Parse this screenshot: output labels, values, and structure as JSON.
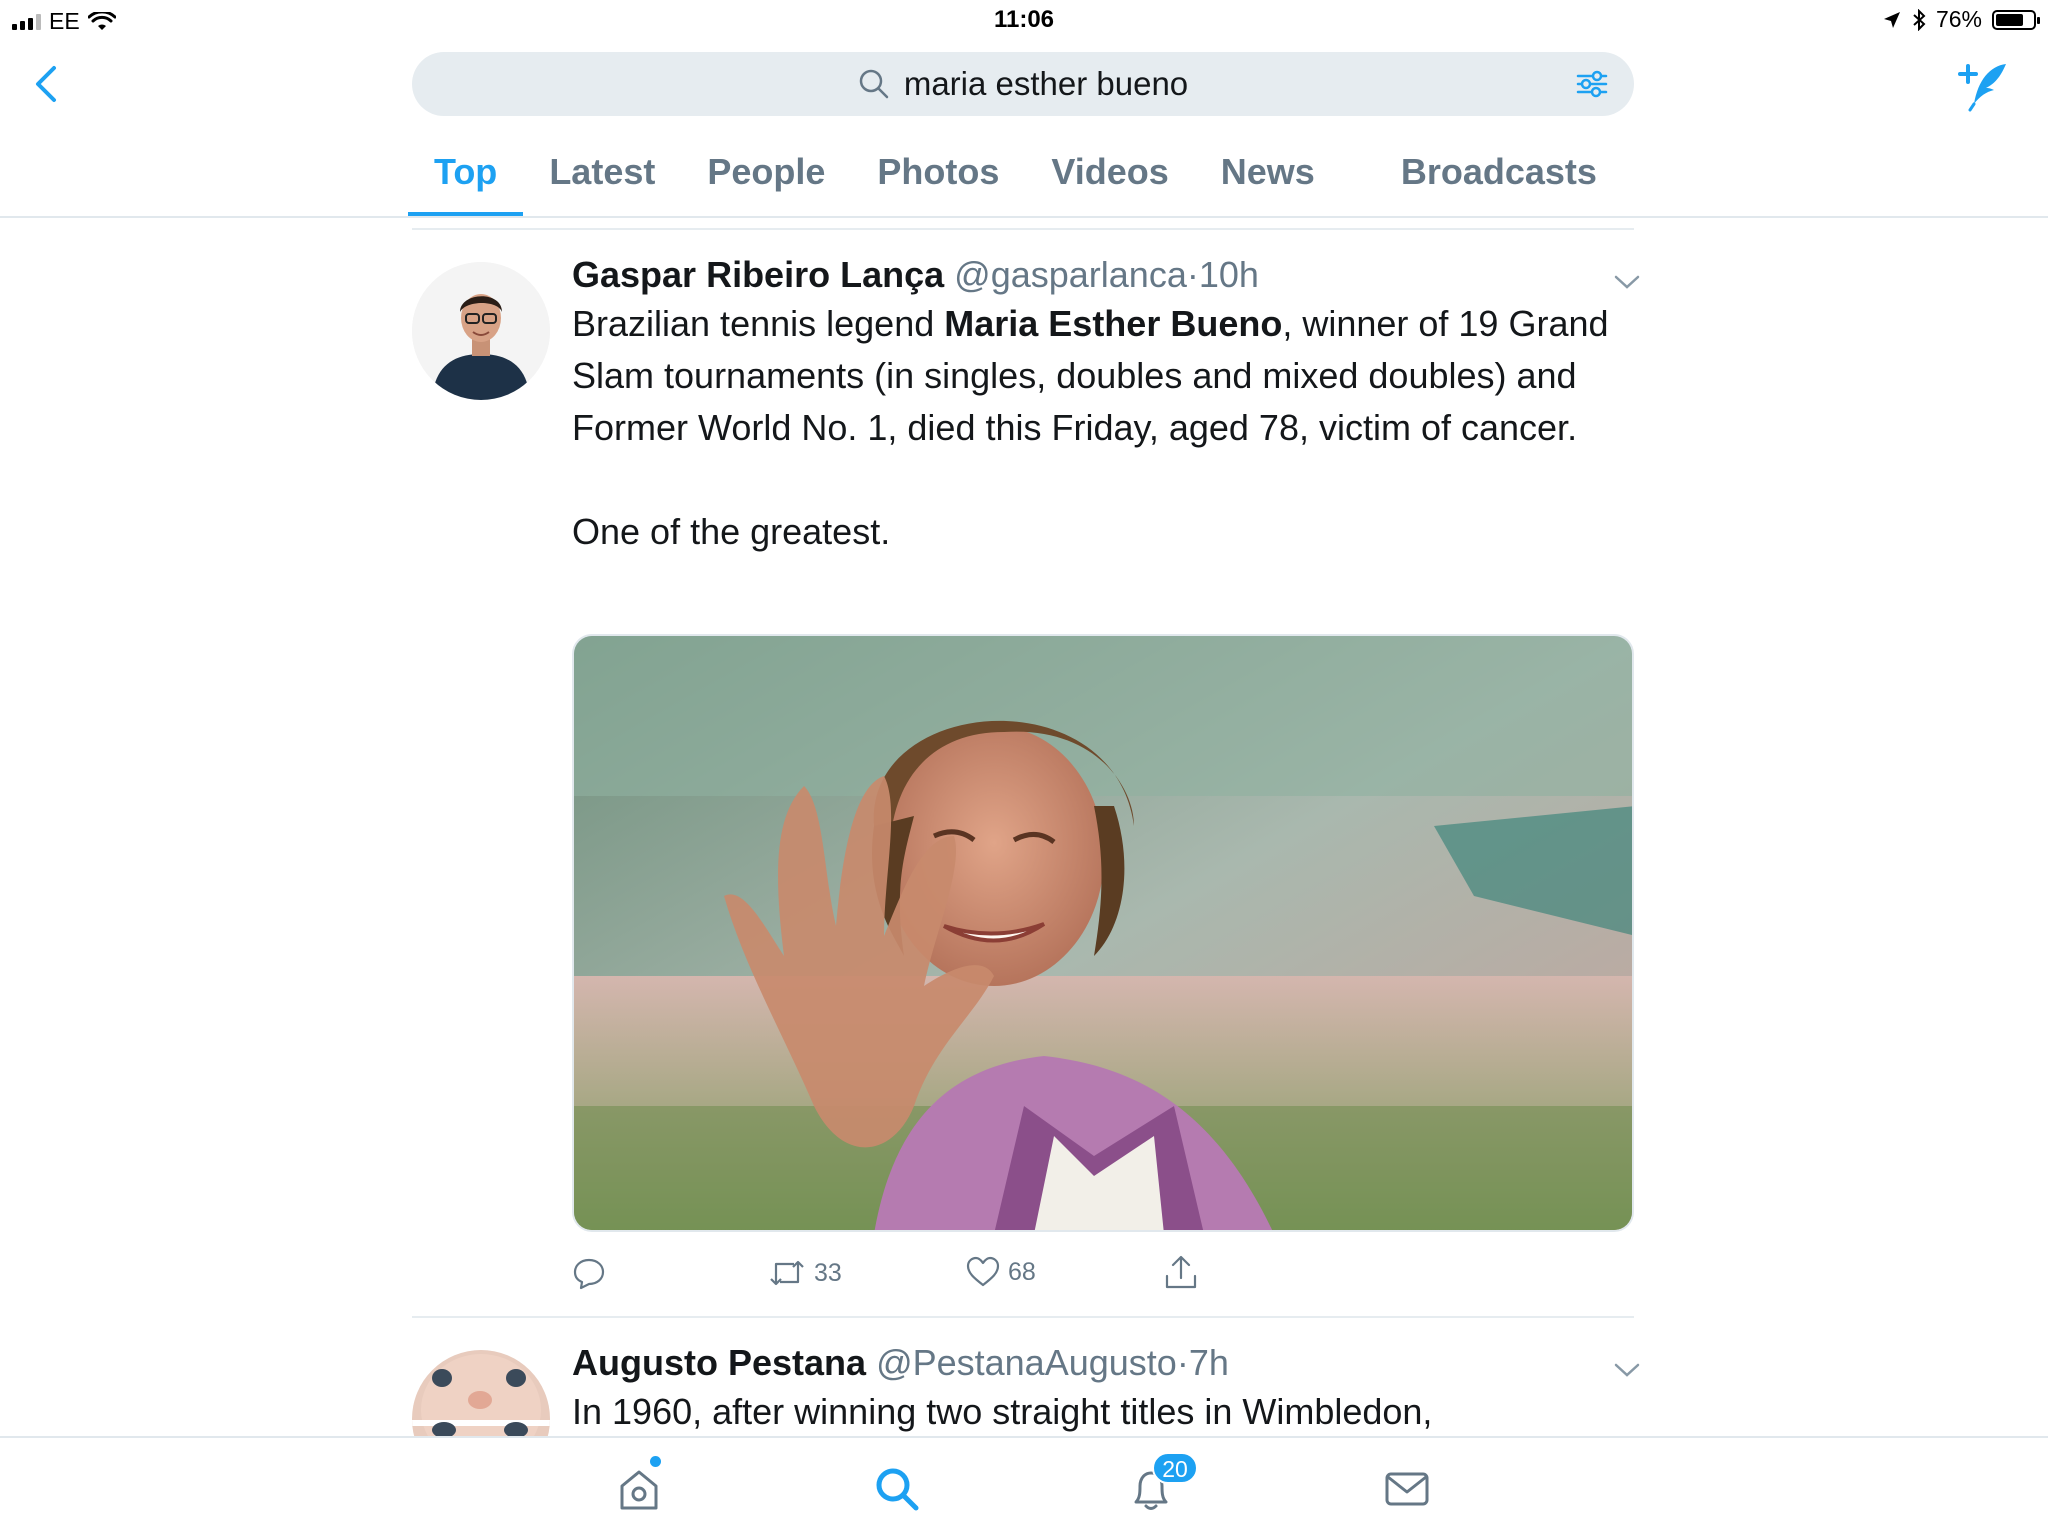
{
  "status_bar": {
    "carrier": "EE",
    "time": "11:06",
    "battery": "76%",
    "battery_level": 0.76
  },
  "search": {
    "query": "maria esther bueno"
  },
  "tabs": [
    {
      "label": "Top",
      "active": true
    },
    {
      "label": "Latest",
      "active": false
    },
    {
      "label": "People",
      "active": false
    },
    {
      "label": "Photos",
      "active": false
    },
    {
      "label": "Videos",
      "active": false
    },
    {
      "label": "News",
      "active": false
    },
    {
      "label": "Broadcasts",
      "active": false
    }
  ],
  "tweets": [
    {
      "name": "Gaspar Ribeiro Lança",
      "handle": "@gasparlanca",
      "separator": "·",
      "time": "10h",
      "text_before": "Brazilian tennis legend ",
      "text_bold": "Maria Esther Bueno",
      "text_after": ", winner of 19 Grand Slam tournaments (in singles, doubles and mixed doubles) and Former World No. 1, died this Friday, aged 78, victim of cancer.",
      "text_line2": "One of the greatest.",
      "retweets": "33",
      "likes": "68"
    },
    {
      "name": "Augusto Pestana",
      "handle": "@PestanaAugusto",
      "separator": "·",
      "time": "7h",
      "text": "In 1960, after winning two straight titles in Wimbledon,"
    }
  ],
  "tabbar": {
    "notifications_badge": "20"
  },
  "colors": {
    "accent": "#1da1f2",
    "secondary_text": "#657786",
    "search_bg": "#e6ecf0"
  }
}
